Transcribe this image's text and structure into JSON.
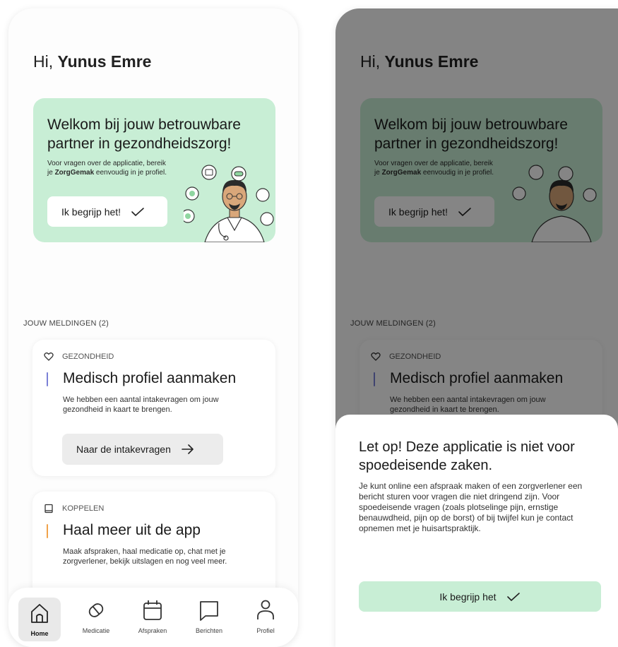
{
  "greeting": {
    "prefix": "Hi, ",
    "name": "Yunus Emre"
  },
  "welcome": {
    "title": "Welkom bij jouw betrouwbare partner in gezondheidszorg!",
    "sub_line1": "Voor vragen over de applicatie, bereik",
    "sub_pre": "je ",
    "sub_brand": "ZorgGemak",
    "sub_post": " eenvoudig in je profiel.",
    "button_label": "Ik begrijp het!"
  },
  "notifications": {
    "section_title": "JOUW MELDINGEN (2)",
    "items": [
      {
        "category": "GEZONDHEID",
        "title": "Medisch profiel aanmaken",
        "description": "We hebben een aantal intakevragen om jouw gezondheid in kaart te brengen.",
        "button_label": "Naar de intakevragen",
        "accent": "#7a80d6"
      },
      {
        "category": "KOPPELEN",
        "title": "Haal meer uit de app",
        "description": "Maak afspraken, haal medicatie op, chat met je zorgverlener, bekijk uitslagen en nog veel meer.",
        "accent": "#f0a24a"
      }
    ]
  },
  "tabbar": {
    "tabs": [
      {
        "label": "Home"
      },
      {
        "label": "Medicatie"
      },
      {
        "label": "Afspraken"
      },
      {
        "label": "Berichten"
      },
      {
        "label": "Profiel"
      }
    ]
  },
  "modal": {
    "title": "Let op! Deze applicatie is niet voor spoedeisende zaken.",
    "body": "Je kunt online een afspraak maken of een zorgverlener een bericht sturen voor vragen die niet dringend zijn. Voor spoedeisende vragen (zoals plotselinge pijn, ernstige benauwdheid, pijn op de borst) of bij twijfel kun je contact opnemen met je huisartspraktijk.",
    "button_label": "Ik begrijp het"
  },
  "colors": {
    "mint": "#c8eed5",
    "overlay": "rgba(0,0,0,0.48)"
  }
}
